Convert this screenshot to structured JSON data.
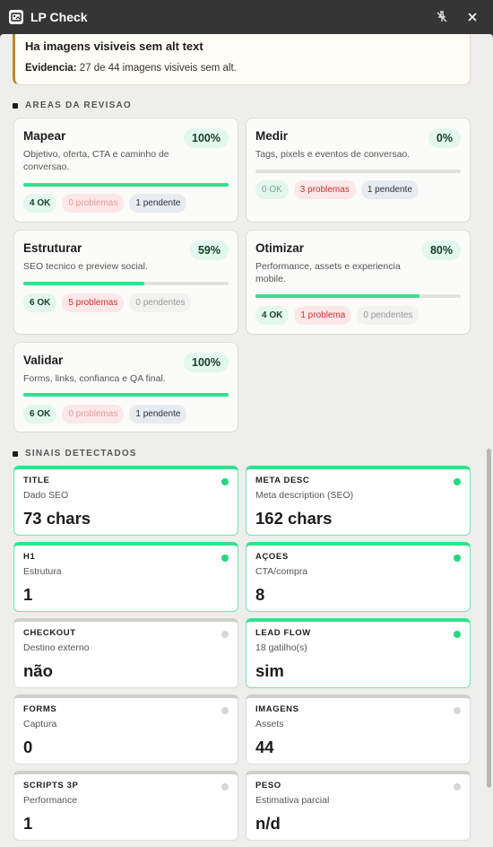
{
  "window": {
    "title": "LP Check",
    "icons": [
      "app-icon",
      "unpin-icon",
      "close-icon"
    ]
  },
  "alert": {
    "title": "Ha imagens visiveis sem alt text",
    "evidence_label": "Evidencia:",
    "evidence_text": " 27 de 44 imagens visiveis sem alt."
  },
  "areas_header": "AREAS DA REVISAO",
  "areas": [
    {
      "name": "Mapear",
      "desc": "Objetivo, oferta, CTA e caminho de conversao.",
      "pct": "100%",
      "progress": 100,
      "ok": "4 OK",
      "problems": "0 problemas",
      "pending": "1 pendente"
    },
    {
      "name": "Medir",
      "desc": "Tags, pixels e eventos de conversao.",
      "pct": "0%",
      "progress": 0,
      "ok": "0 OK",
      "problems": "3 problemas",
      "pending": "1 pendente"
    },
    {
      "name": "Estruturar",
      "desc": "SEO tecnico e preview social.",
      "pct": "59%",
      "progress": 59,
      "ok": "6 OK",
      "problems": "5 problemas",
      "pending": "0 pendentes"
    },
    {
      "name": "Otimizar",
      "desc": "Performance, assets e experiencia mobile.",
      "pct": "80%",
      "progress": 80,
      "ok": "4 OK",
      "problems": "1 problema",
      "pending": "0 pendentes"
    },
    {
      "name": "Validar",
      "desc": "Forms, links, confianca e QA final.",
      "pct": "100%",
      "progress": 100,
      "ok": "6 OK",
      "problems": "0 problemas",
      "pending": "1 pendente"
    }
  ],
  "signals_header": "SINAIS DETECTADOS",
  "signals": [
    {
      "label": "TITLE",
      "sub": "Dado SEO",
      "value": "73 chars",
      "active": true
    },
    {
      "label": "META DESC",
      "sub": "Meta description (SEO)",
      "value": "162 chars",
      "active": true
    },
    {
      "label": "H1",
      "sub": "Estrutura",
      "value": "1",
      "active": true
    },
    {
      "label": "AÇOES",
      "sub": "CTA/compra",
      "value": "8",
      "active": true
    },
    {
      "label": "CHECKOUT",
      "sub": "Destino externo",
      "value": "não",
      "active": false
    },
    {
      "label": "LEAD FLOW",
      "sub": "18 gatilho(s)",
      "value": "sim",
      "active": true
    },
    {
      "label": "FORMS",
      "sub": "Captura",
      "value": "0",
      "active": false
    },
    {
      "label": "IMAGENS",
      "sub": "Assets",
      "value": "44",
      "active": false
    },
    {
      "label": "SCRIPTS 3P",
      "sub": "Performance",
      "value": "1",
      "active": false
    },
    {
      "label": "PESO",
      "sub": "Estimativa parcial",
      "value": "n/d",
      "active": false
    }
  ],
  "colors": {
    "accent": "#2ee38f",
    "problem": "#c83232",
    "warning_border": "#b88a2a"
  }
}
